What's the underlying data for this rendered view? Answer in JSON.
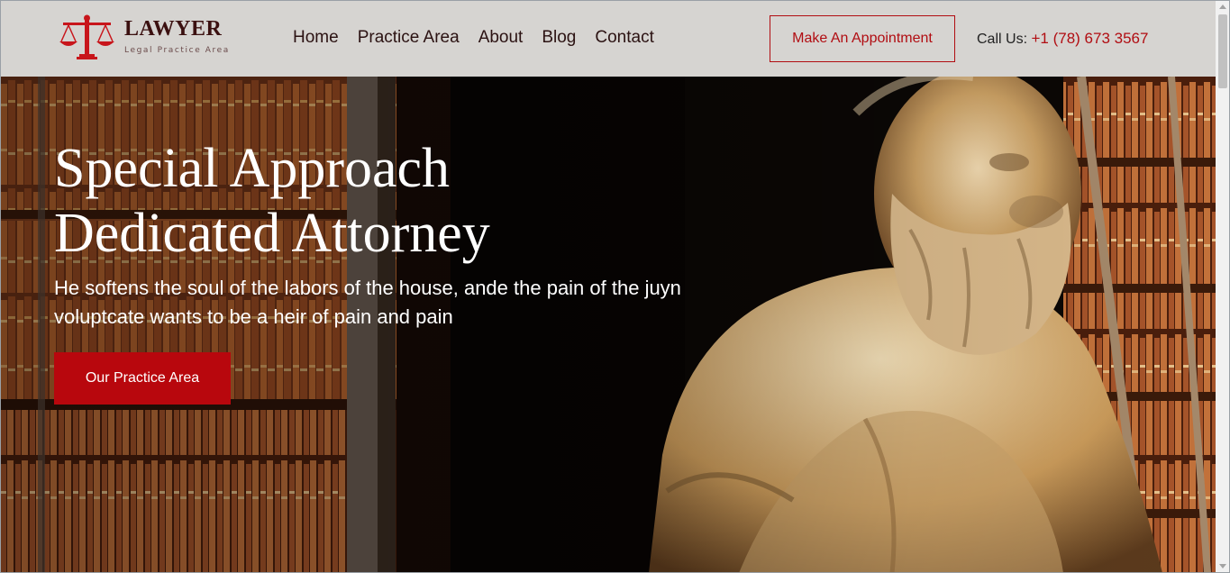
{
  "brand": {
    "title": "LAWYER",
    "subtitle": "Legal Practice Area",
    "icon": "scales-of-justice-icon",
    "accent_color": "#b10d12"
  },
  "nav": {
    "items": [
      {
        "label": "Home"
      },
      {
        "label": "Practice Area"
      },
      {
        "label": "About"
      },
      {
        "label": "Blog"
      },
      {
        "label": "Contact"
      }
    ]
  },
  "header": {
    "appointment_label": "Make An Appointment",
    "call_label": "Call Us:",
    "phone": "+1 (78) 673 3567",
    "background_color": "#d6d4d1"
  },
  "hero": {
    "title_line1": "Special Approach",
    "title_line2": "Dedicated Attorney",
    "text": "He softens the soul of the labors of the house, ande the pain of the juyn voluptcate wants to be a heir of pain and pain",
    "button_label": "Our Practice Area",
    "button_color": "#b8070d"
  }
}
